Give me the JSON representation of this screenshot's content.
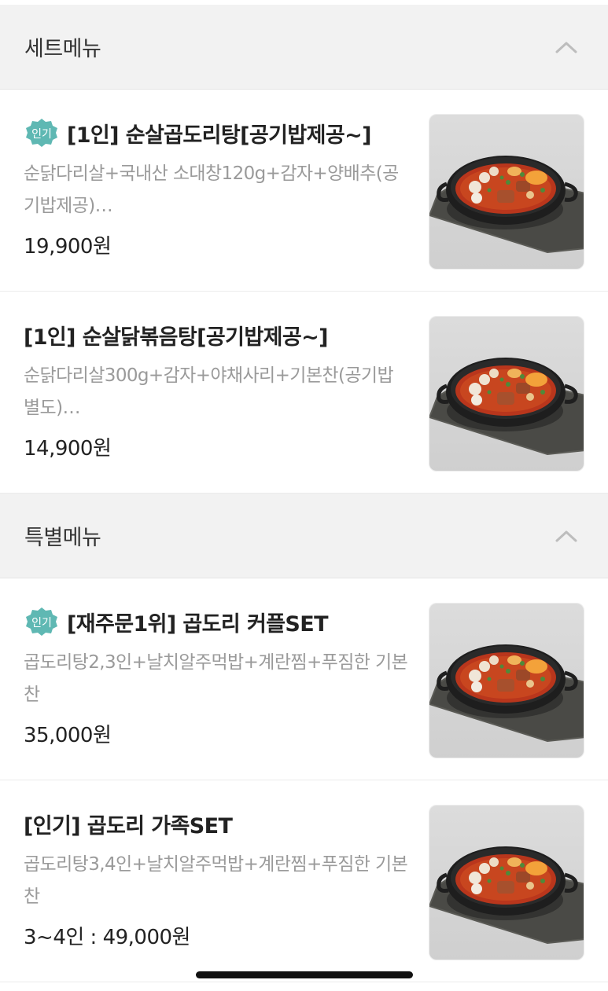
{
  "sections": [
    {
      "title": "세트메뉴",
      "collapse_icon": "chevron-up-icon",
      "items": [
        {
          "badge": "인기",
          "name": "[1인] 순살곱도리탕[공기밥제공~]",
          "description": "순닭다리살+국내산 소대창120g+감자+양배추(공기밥제공)…",
          "price": "19,900원",
          "image": "stew-pot-image"
        },
        {
          "badge": "",
          "name": "[1인] 순살닭볶음탕[공기밥제공~]",
          "description": "순닭다리살300g+감자+야채사리+기본찬(공기밥 별도)…",
          "price": "14,900원",
          "image": "stew-pot-image"
        }
      ]
    },
    {
      "title": "특별메뉴",
      "collapse_icon": "chevron-up-icon",
      "items": [
        {
          "badge": "인기",
          "name": "[재주문1위] 곱도리 커플SET",
          "description": "곱도리탕2,3인+날치알주먹밥+계란찜+푸짐한 기본찬",
          "price": "35,000원",
          "image": "stew-pot-image"
        },
        {
          "badge": "",
          "name": "[인기] 곱도리 가족SET",
          "description": "곱도리탕3,4인+날치알주먹밥+계란찜+푸짐한 기본찬",
          "price": "3~4인 : 49,000원",
          "image": "stew-pot-image"
        }
      ]
    }
  ],
  "colors": {
    "badge_teal": "#5fb8b3",
    "header_bg": "#f2f2f2",
    "desc_gray": "#9a9a9a"
  }
}
